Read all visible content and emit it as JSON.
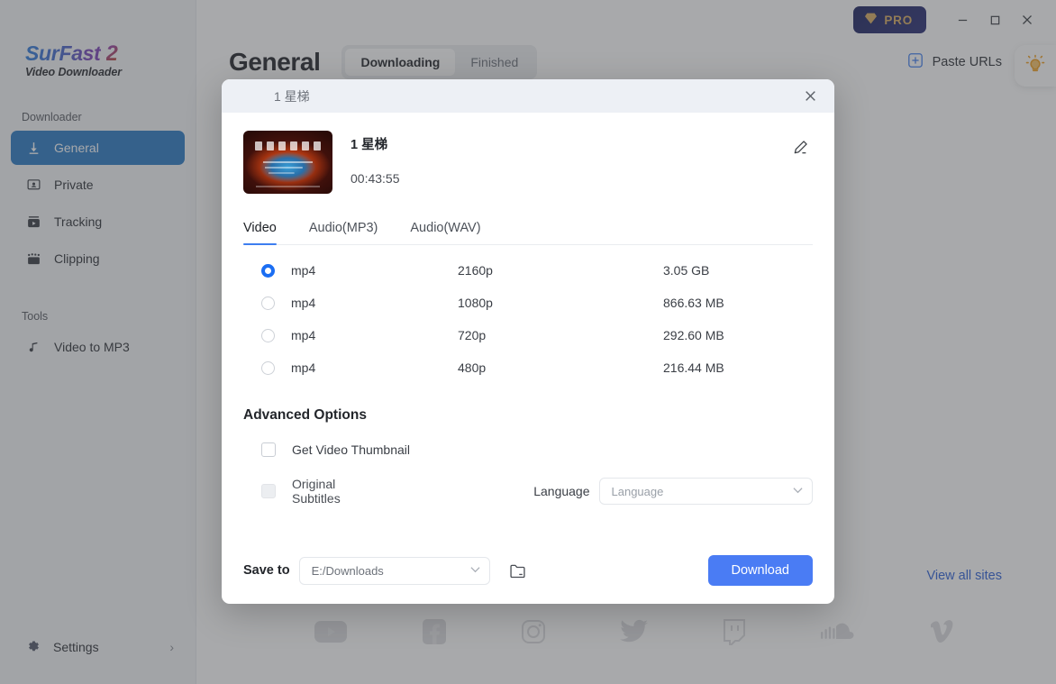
{
  "sidebar": {
    "logo": {
      "main": "SurFast",
      "two": "2",
      "sub": "Video Downloader"
    },
    "downloader_label": "Downloader",
    "downloader_items": [
      {
        "label": "General",
        "icon": "download-arrow-icon",
        "active": true
      },
      {
        "label": "Private",
        "icon": "private-screen-icon",
        "active": false
      },
      {
        "label": "Tracking",
        "icon": "tracking-box-icon",
        "active": false
      },
      {
        "label": "Clipping",
        "icon": "clipping-film-icon",
        "active": false
      }
    ],
    "tools_label": "Tools",
    "tools_items": [
      {
        "label": "Video to MP3",
        "icon": "music-note-icon"
      }
    ],
    "settings_label": "Settings",
    "settings_chevron": "›"
  },
  "titlebar": {
    "pro_label": "PRO",
    "minimize": "–",
    "maximize": "□",
    "close": "✕"
  },
  "page": {
    "title": "General",
    "tabs": [
      {
        "label": "Downloading",
        "active": true
      },
      {
        "label": "Finished",
        "active": false
      }
    ],
    "paste_urls_label": "Paste URLs",
    "view_all_sites_label": "View all sites",
    "sites": [
      "youtube-icon",
      "facebook-icon",
      "instagram-icon",
      "twitter-icon",
      "twitch-icon",
      "soundcloud-icon",
      "vimeo-icon"
    ]
  },
  "modal": {
    "header_title": "1 星梯",
    "close_icon": "close-icon",
    "video": {
      "title": "1 星梯",
      "duration": "00:43:55",
      "edit_icon": "pencil-edit-icon"
    },
    "format_tabs": [
      {
        "label": "Video",
        "active": true
      },
      {
        "label": "Audio(MP3)",
        "active": false
      },
      {
        "label": "Audio(WAV)",
        "active": false
      }
    ],
    "formats": [
      {
        "ext": "mp4",
        "resolution": "2160p",
        "size": "3.05 GB",
        "selected": true
      },
      {
        "ext": "mp4",
        "resolution": "1080p",
        "size": "866.63 MB",
        "selected": false
      },
      {
        "ext": "mp4",
        "resolution": "720p",
        "size": "292.60 MB",
        "selected": false
      },
      {
        "ext": "mp4",
        "resolution": "480p",
        "size": "216.44 MB",
        "selected": false
      }
    ],
    "advanced": {
      "title": "Advanced Options",
      "thumbnail_label": "Get Video Thumbnail",
      "thumbnail_checked": false,
      "subtitles_label": "Original Subtitles",
      "subtitles_checked": false,
      "subtitles_disabled": true,
      "language_label": "Language",
      "language_value": "Language"
    },
    "footer": {
      "save_to_label": "Save to",
      "save_path": "E:/Downloads",
      "folder_icon": "folder-open-icon",
      "download_label": "Download"
    }
  },
  "colors": {
    "accent_blue": "#4a7cf4",
    "sidebar_active": "#2b7ac4",
    "tab_underline": "#3d7ef0",
    "pro_gold": "#d9ad62",
    "pro_navy": "#1c2360",
    "link_blue": "#2f62d8",
    "bulb_orange": "#f0a020"
  }
}
